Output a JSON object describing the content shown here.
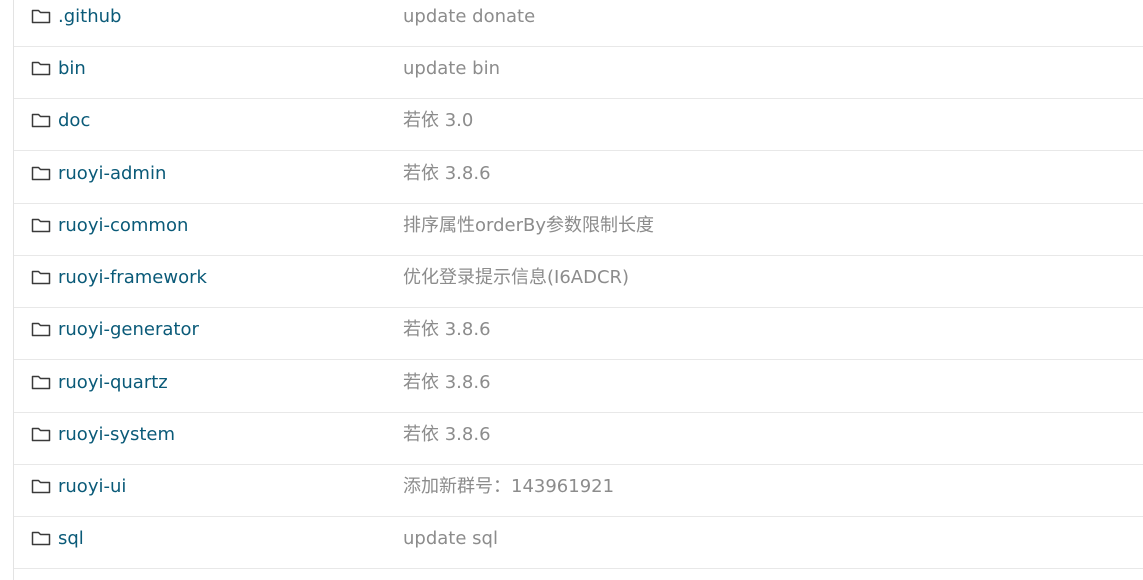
{
  "file_list": {
    "rows": [
      {
        "icon": "folder-icon",
        "name": ".github",
        "commit_message": "update donate"
      },
      {
        "icon": "folder-icon",
        "name": "bin",
        "commit_message": "update bin"
      },
      {
        "icon": "folder-icon",
        "name": "doc",
        "commit_message": "若依 3.0"
      },
      {
        "icon": "folder-icon",
        "name": "ruoyi-admin",
        "commit_message": "若依 3.8.6"
      },
      {
        "icon": "folder-icon",
        "name": "ruoyi-common",
        "commit_message": "排序属性orderBy参数限制长度"
      },
      {
        "icon": "folder-icon",
        "name": "ruoyi-framework",
        "commit_message": "优化登录提示信息(I6ADCR)"
      },
      {
        "icon": "folder-icon",
        "name": "ruoyi-generator",
        "commit_message": "若依 3.8.6"
      },
      {
        "icon": "folder-icon",
        "name": "ruoyi-quartz",
        "commit_message": "若依 3.8.6"
      },
      {
        "icon": "folder-icon",
        "name": "ruoyi-system",
        "commit_message": "若依 3.8.6"
      },
      {
        "icon": "folder-icon",
        "name": "ruoyi-ui",
        "commit_message": "添加新群号：143961921"
      },
      {
        "icon": "folder-icon",
        "name": "sql",
        "commit_message": "update sql"
      }
    ]
  },
  "colors": {
    "link": "#0a5a78",
    "commit_text": "#8c8c8c",
    "row_border": "#e8e8e8",
    "folder_icon": "#3a3a3a"
  }
}
